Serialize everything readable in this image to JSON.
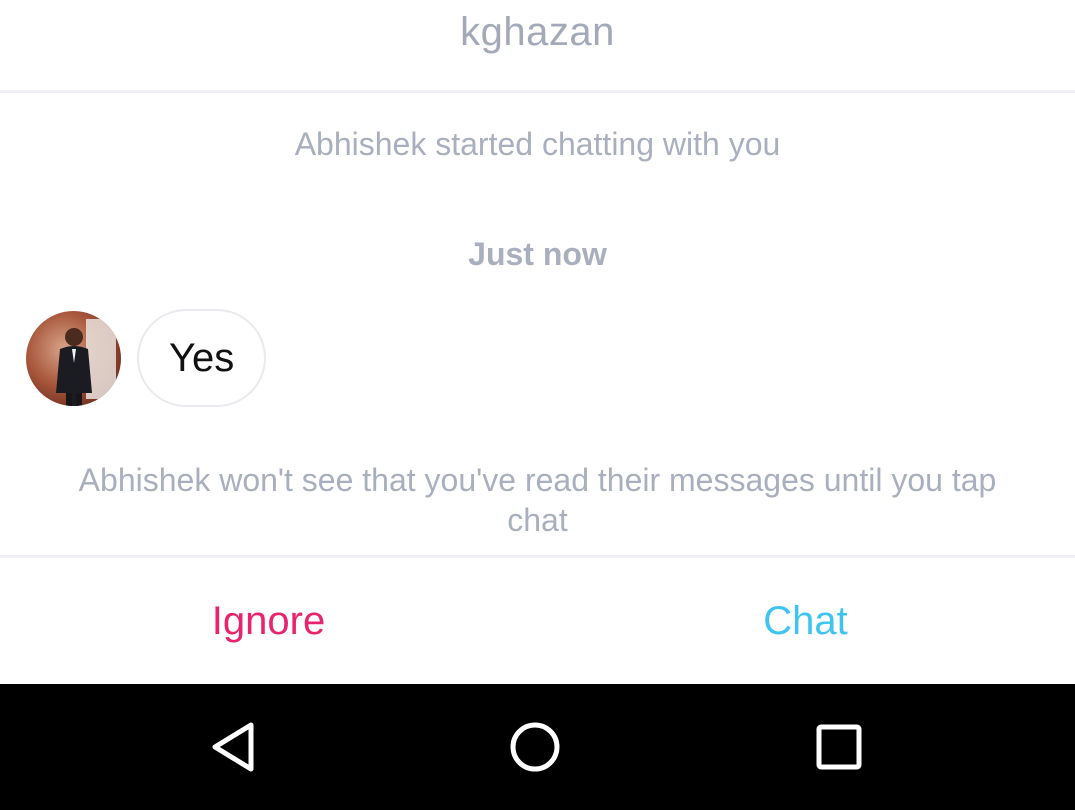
{
  "header": {
    "title": "kghazan"
  },
  "conversation": {
    "started_notice": "Abhishek started chatting with you",
    "timestamp": "Just now",
    "messages": [
      {
        "text": "Yes"
      }
    ]
  },
  "read_notice": "Abhishek won't see that you've read their messages until you tap chat",
  "actions": {
    "ignore_label": "Ignore",
    "chat_label": "Chat"
  },
  "colors": {
    "ignore": "#e8246f",
    "chat": "#3ec4ef",
    "muted_text": "#a9afbe"
  },
  "navbar": {
    "back_icon": "back-triangle-icon",
    "home_icon": "home-circle-icon",
    "recents_icon": "recents-square-icon"
  }
}
